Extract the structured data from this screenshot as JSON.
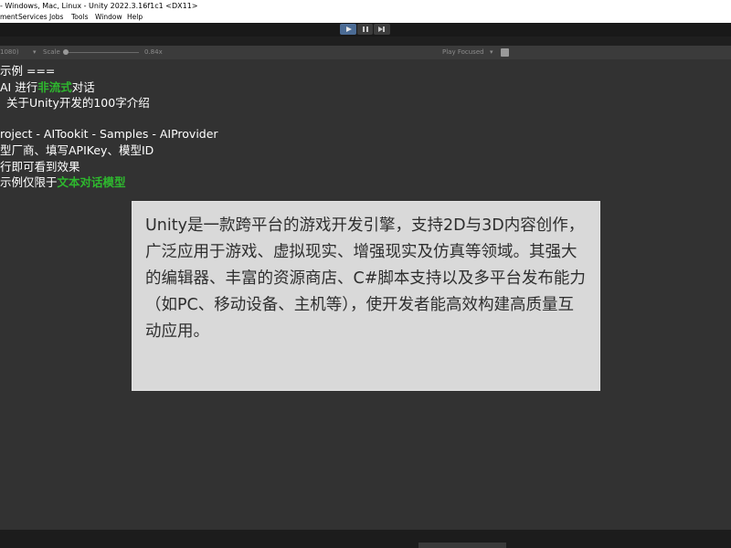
{
  "window": {
    "title": "- Windows, Mac, Linux - Unity 2022.3.16f1c1 <DX11>"
  },
  "menu": {
    "items": [
      "ment",
      "Services",
      "Jobs",
      "Tools",
      "Window",
      "Help"
    ]
  },
  "toolbar": {
    "play_icon": "play-icon",
    "pause_icon": "pause-icon",
    "step_icon": "step-icon",
    "play_active": true
  },
  "game_toolbar": {
    "resolution": "1080)",
    "scale_label": "Scale",
    "scale_value": "0.84x",
    "play_mode": "Play Focused"
  },
  "instructions": {
    "line1": "示例 ===",
    "line2_prefix": "AI 进行",
    "line2_highlight": "非流式",
    "line2_suffix": "对话",
    "line3": "关于Unity开发的100字介绍",
    "line4": "roject - AITookit - Samples - AIProvider",
    "line5": "型厂商、填写APIKey、模型ID",
    "line6": "行即可看到效果",
    "line7_prefix": "示例仅限于",
    "line7_highlight": "文本对话模型"
  },
  "response": {
    "text": "Unity是一款跨平台的游戏开发引擎，支持2D与3D内容创作，广泛应用于游戏、虚拟现实、增强现实及仿真等领域。其强大的编辑器、丰富的资源商店、C#脚本支持以及多平台发布能力（如PC、移动设备、主机等），使开发者能高效构建高质量互动应用。"
  },
  "colors": {
    "highlight": "#2eb82e",
    "panel_bg": "#d9d9d9",
    "editor_bg": "#323232"
  }
}
